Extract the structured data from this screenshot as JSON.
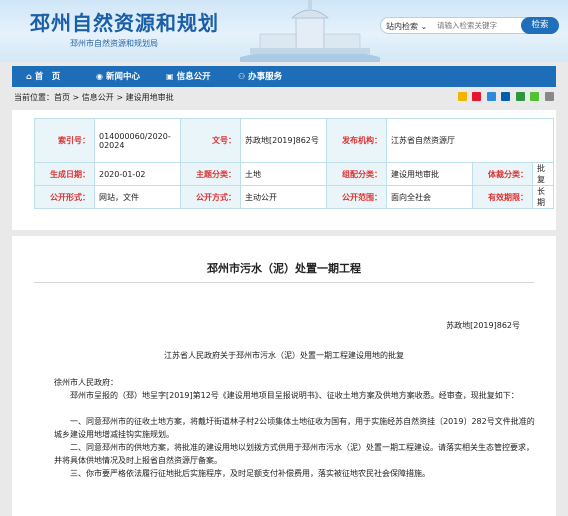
{
  "header": {
    "title": "邳州自然资源和规划",
    "subtitle": "邳州市自然资源和规划局"
  },
  "search": {
    "scope": "站内检索",
    "placeholder": "请输入检索关键字",
    "button": "检索"
  },
  "nav": [
    {
      "label": "首　页",
      "icon": "home-icon"
    },
    {
      "label": "新闻中心",
      "icon": "news-icon"
    },
    {
      "label": "信息公开",
      "icon": "info-icon"
    },
    {
      "label": "办事服务",
      "icon": "service-icon"
    }
  ],
  "breadcrumb": {
    "prefix": "当前位置：",
    "items": [
      "首页",
      "信息公开",
      "建设用地审批"
    ],
    "separator": " > "
  },
  "meta": {
    "index_label": "索引号：",
    "index_value": "014000060/2020-02024",
    "docno_label": "文号：",
    "docno_value": "苏政地[2019]862号",
    "publisher_label": "发布机构：",
    "publisher_value": "江苏省自然资源厅",
    "date_label": "生成日期：",
    "date_value": "2020-01-02",
    "topic_label": "主题分类：",
    "topic_value": "土地",
    "org_label": "组配分类：",
    "org_value": "建设用地审批",
    "carrier_label": "体裁分类：",
    "carrier_value": "批复",
    "form_label": "公开形式：",
    "form_value": "网站，文件",
    "mode_label": "公开方式：",
    "mode_value": "主动公开",
    "scope_label": "公开范围：",
    "scope_value": "面向全社会",
    "term_label": "有效期限：",
    "term_value": "长期"
  },
  "article": {
    "title": "邳州市污水（泥）处置一期工程",
    "docno": "苏政地[2019]862号",
    "subtitle": "江苏省人民政府关于邳州市污水（泥）处置一期工程建设用地的批复",
    "paragraphs": [
      "徐州市人民政府：",
      "　　邳州市呈报的（邳）地呈字[2019]第12号《建设用地项目呈报说明书》、征收土地方案及供地方案收悉。经审查，现批复如下：",
      "　　一、同意邳州市的征收土地方案，将戴圩街道林子村2公顷集体土地征收为国有，用于实施经苏自然资挂〔2019〕282号文件批准的城乡建设用地增减挂钩实施规划。",
      "　　二、同意邳州市的供地方案，将批准的建设用地以划拨方式供用于邳州市污水（泥）处置一期工程建设。请落实相关生态管控要求，并将具体供地情况及时上报省自然资源厅备案。",
      "　　三、你市要严格依法履行征地批后实施程序，及时足额支付补偿费用，落实被征地农民社会保障措施。"
    ]
  },
  "colors": {
    "brand": "#1e6db8",
    "label_red": "#d33",
    "cell_border": "#bfe0ea"
  }
}
